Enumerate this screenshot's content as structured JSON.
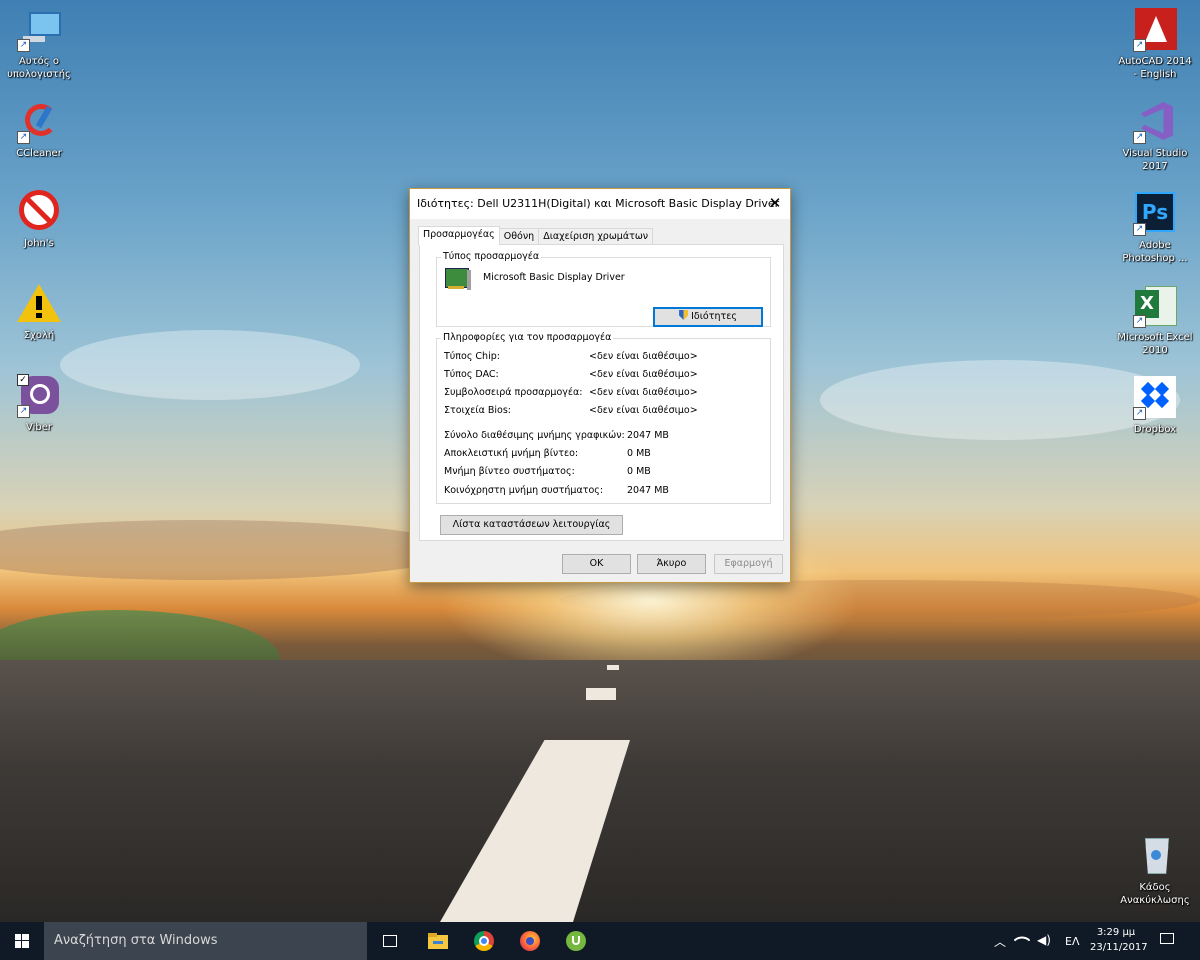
{
  "desktop": {
    "left_icons": [
      {
        "label": "Αυτός ο υπολογιστής",
        "icon": "computer-icon"
      },
      {
        "label": "CCleaner",
        "icon": "ccleaner-icon"
      },
      {
        "label": "John's",
        "icon": "no-entry-icon"
      },
      {
        "label": "Σχολή",
        "icon": "warning-icon"
      },
      {
        "label": "Viber",
        "icon": "viber-icon"
      }
    ],
    "right_icons": [
      {
        "label": "AutoCAD 2014 - English",
        "icon": "autocad-icon"
      },
      {
        "label": "Visual Studio 2017",
        "icon": "visual-studio-icon"
      },
      {
        "label": "Adobe Photoshop ...",
        "icon": "photoshop-icon",
        "glyph": "Ps"
      },
      {
        "label": "Microsoft Excel 2010",
        "icon": "excel-icon",
        "glyph": "X"
      },
      {
        "label": "Dropbox",
        "icon": "dropbox-icon"
      }
    ],
    "recycle_bin": {
      "label": "Κάδος Ανακύκλωσης",
      "icon": "recycle-bin-icon"
    }
  },
  "dialog": {
    "title": "Ιδιότητες: Dell U2311H(Digital) και Microsoft Basic Display Driver",
    "close_glyph": "✕",
    "tabs": [
      "Προσαρμογέας",
      "Οθόνη",
      "Διαχείριση χρωμάτων"
    ],
    "active_tab": "Προσαρμογέας",
    "adapter_group": {
      "legend": "Τύπος προσαρμογέα",
      "adapter_name": "Microsoft Basic Display Driver",
      "properties_button": "Ιδιότητες"
    },
    "info_group": {
      "legend": "Πληροφορίες για τον προσαρμογέα",
      "rows": [
        {
          "label": "Τύπος Chip:",
          "value": "<δεν είναι διαθέσιμο>"
        },
        {
          "label": "Τύπος DAC:",
          "value": "<δεν είναι διαθέσιμο>"
        },
        {
          "label": "Συμβολοσειρά προσαρμογέα:",
          "value": "<δεν είναι διαθέσιμο>"
        },
        {
          "label": "Στοιχεία Bios:",
          "value": "<δεν είναι διαθέσιμο>"
        }
      ],
      "memory_rows": [
        {
          "label": "Σύνολο διαθέσιμης μνήμης γραφικών:",
          "value": "2047 MB"
        },
        {
          "label": "Αποκλειστική μνήμη βίντεο:",
          "value": "0 MB"
        },
        {
          "label": "Μνήμη βίντεο συστήματος:",
          "value": "0 MB"
        },
        {
          "label": "Κοινόχρηστη μνήμη συστήματος:",
          "value": "2047 MB"
        }
      ]
    },
    "list_modes_button": "Λίστα καταστάσεων λειτουργίας",
    "ok_button": "OK",
    "cancel_button": "Άκυρο",
    "apply_button": "Εφαρμογή"
  },
  "taskbar": {
    "search_placeholder": "Αναζήτηση στα Windows",
    "language": "ΕΛ",
    "time": "3:29 μμ",
    "date": "23/11/2017",
    "pinned": [
      "task-view-icon",
      "file-explorer-icon",
      "chrome-icon",
      "firefox-icon",
      "utorrent-icon"
    ]
  }
}
